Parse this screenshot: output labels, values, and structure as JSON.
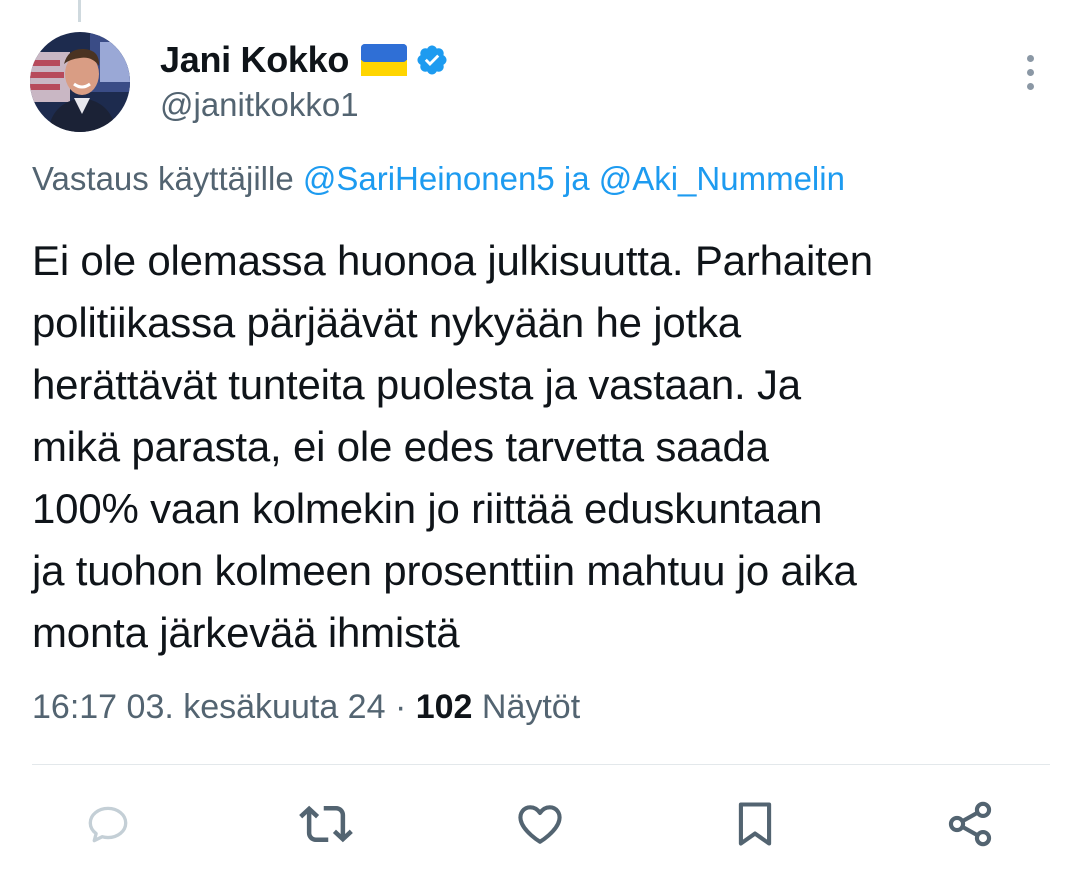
{
  "author": {
    "display_name": "Jani Kokko",
    "flag_icon": "ukraine-flag-icon",
    "verified_icon": "verified-badge-icon",
    "handle": "@janitkokko1"
  },
  "reply": {
    "prefix": "Vastaus käyttäjille ",
    "mention_1": "@SariHeinonen5",
    "joiner": " ja ",
    "mention_2": "@Aki_Nummelin"
  },
  "tweet": {
    "text": "Ei ole olemassa huonoa julkisuutta. Parhaiten\npolitiikassa pärjäävät nykyään he jotka\nherättävät tunteita puolesta ja vastaan. Ja\nmikä parasta, ei ole edes tarvetta saada\n100% vaan kolmekin jo riittää eduskuntaan\nja tuohon kolmeen prosenttiin mahtuu jo aika\nmonta järkevää ihmistä"
  },
  "meta": {
    "timestamp": "16:17 03. kesäkuuta 24",
    "separator": " · ",
    "views_count": "102",
    "views_label": " Näytöt"
  },
  "actions": {
    "reply_icon": "reply-icon",
    "retweet_icon": "retweet-icon",
    "like_icon": "heart-icon",
    "bookmark_icon": "bookmark-icon",
    "share_icon": "share-icon"
  },
  "colors": {
    "accent": "#1d9bf0",
    "secondary_text": "#536471",
    "primary_text": "#0f1419",
    "action_icon": "#536471"
  }
}
